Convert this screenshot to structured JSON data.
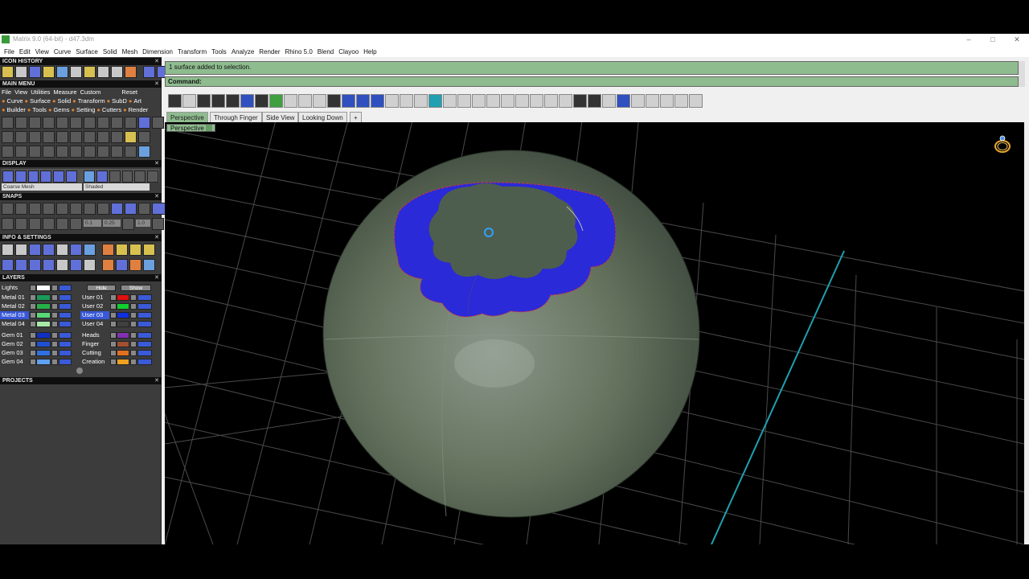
{
  "window": {
    "title": "Matrix 9.0 (64-bit) - d47.3dm"
  },
  "menubar": [
    "File",
    "Edit",
    "View",
    "Curve",
    "Surface",
    "Solid",
    "Mesh",
    "Dimension",
    "Transform",
    "Tools",
    "Analyze",
    "Render",
    "Rhino 5.0",
    "Blend",
    "Clayoo",
    "Help"
  ],
  "left": {
    "icon_history": "ICON HISTORY",
    "main_menu": "MAIN MENU",
    "main_menu_row1": [
      "File",
      "View",
      "Utilities",
      "Measure",
      "Custom"
    ],
    "reset": "Reset",
    "main_menu_row2": [
      "Curve",
      "Surface",
      "Solid",
      "Transform",
      "SubD",
      "Art"
    ],
    "main_menu_row3": [
      "Builder",
      "Tools",
      "Gems",
      "Setting",
      "Cutters",
      "Render"
    ],
    "display": "DISPLAY",
    "display_mesh": "Coarse Mesh",
    "display_shade": "Shaded",
    "snaps": "SNAPS",
    "snap_values": [
      "0.1",
      "0.25",
      "1.0"
    ],
    "info_settings": "INFO & SETTINGS",
    "layers": "LAYERS",
    "lights": "Lights",
    "hide": "Hide",
    "show": "Show",
    "layer_col1": [
      "Metal 01",
      "Metal 02",
      "Metal 03",
      "Metal 04"
    ],
    "layer_col2": [
      "User 01",
      "User 02",
      "User 03",
      "User 04"
    ],
    "layer_col3": [
      "Gem 01",
      "Gem 02",
      "Gem 03",
      "Gem 04"
    ],
    "layer_col4": [
      "Heads",
      "Finger",
      "Cutting",
      "Creation"
    ],
    "projects": "PROJECTS"
  },
  "command": {
    "history": "1 surface added to selection.",
    "prompt": "Command:"
  },
  "tabs": [
    "Perspective",
    "Through Finger",
    "Side View",
    "Looking Down",
    "+"
  ],
  "viewport": {
    "label": "Perspective"
  },
  "colors": {
    "cmd_bg": "#8fbc8f",
    "selection": "#2a2ad8",
    "sphere": "#5e6e5e"
  }
}
